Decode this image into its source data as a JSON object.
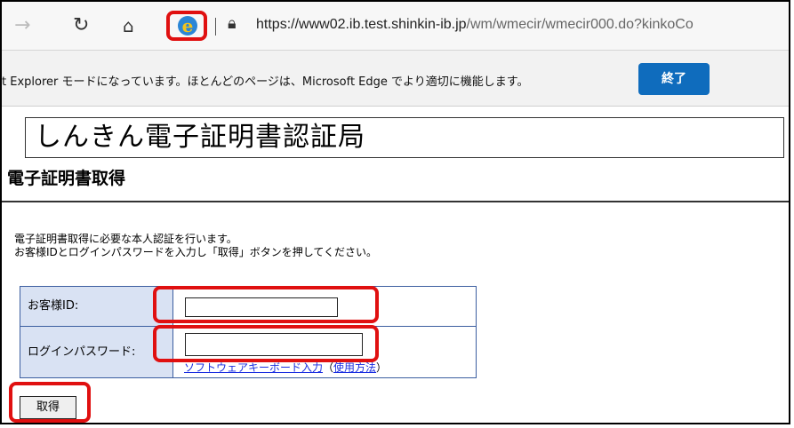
{
  "toolbar": {
    "back_icon": "back-arrow-icon",
    "refresh_icon": "refresh-icon",
    "home_icon": "home-icon",
    "ie_icon": "internet-explorer-icon",
    "lock_icon": "lock-icon",
    "url_host": "https://www02.ib.test.shinkin-ib.jp",
    "url_path": "/wm/wmecir/wmecir000.do?kinkoCo"
  },
  "infobar": {
    "message": "t Explorer モードになっています。ほとんどのページは、Microsoft Edge でより適切に機能します。",
    "exit_label": "終了"
  },
  "page": {
    "site_title": "しんきん電子証明書認証局",
    "heading": "電子証明書取得",
    "description_line1": "電子証明書取得に必要な本人認証を行います。",
    "description_line2": "お客様IDとログインパスワードを入力し「取得」ボタンを押してください。",
    "customer_id_label": "お客様ID:",
    "customer_id_value": "",
    "password_label": "ログインパスワード:",
    "password_value": "",
    "software_keyboard_link": "ソフトウェアキーボード入力",
    "paren_open": "（",
    "usage_link": "使用方法",
    "paren_close": "）",
    "get_button_label": "取得"
  },
  "colors": {
    "highlight": "#e01010",
    "edge_button": "#0f6cbd",
    "label_cell_bg": "#d9e2f3",
    "table_border": "#3c5ea0",
    "link": "#1a2ee0"
  }
}
